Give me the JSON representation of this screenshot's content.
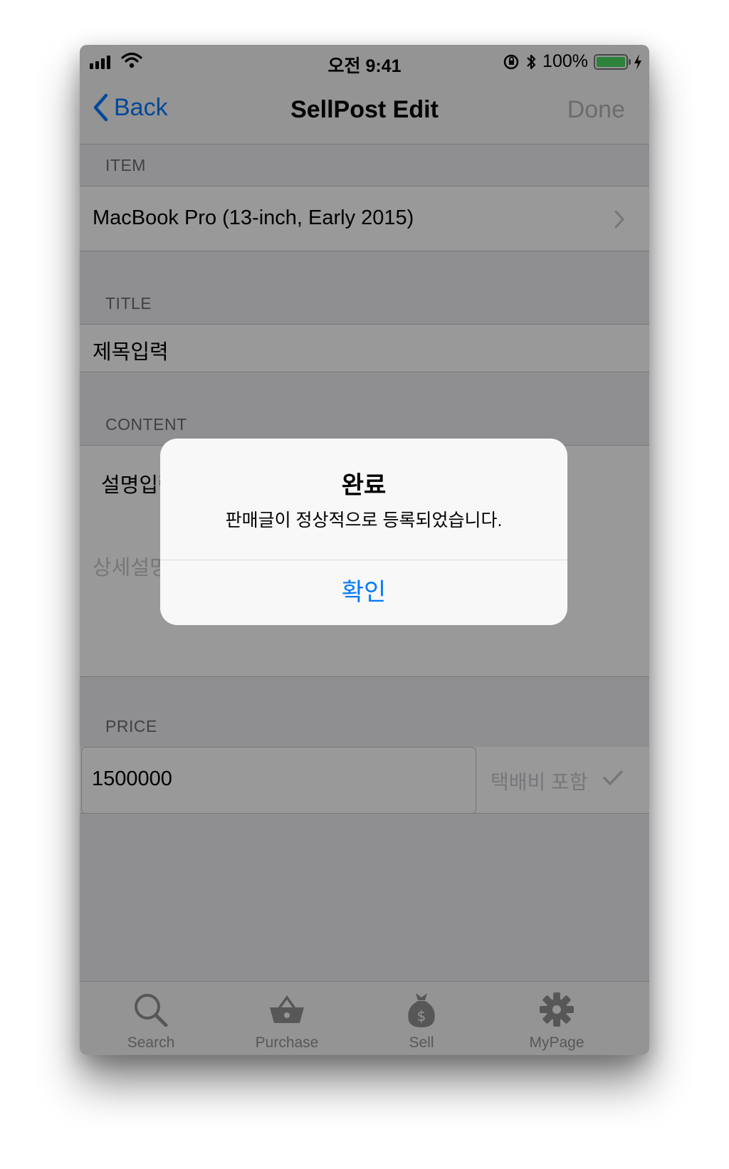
{
  "status_bar": {
    "time": "오전 9:41",
    "battery_percent": "100%",
    "battery_level": 1.0
  },
  "nav": {
    "back_label": "Back",
    "title": "SellPost Edit",
    "done_label": "Done"
  },
  "sections": {
    "item_header": "ITEM",
    "item_value": "MacBook Pro (13-inch, Early 2015)",
    "title_header": "TITLE",
    "title_value": "제목입력",
    "content_header": "CONTENT",
    "content_value": "설명입력",
    "content_placeholder": "상세설명",
    "price_header": "PRICE",
    "price_value": "1500000",
    "shipping_label": "택배비 포함"
  },
  "tab_bar": {
    "items": [
      {
        "label": "Search",
        "icon": "search-icon"
      },
      {
        "label": "Purchase",
        "icon": "basket-icon"
      },
      {
        "label": "Sell",
        "icon": "money-bag-icon"
      },
      {
        "label": "MyPage",
        "icon": "gear-icon"
      }
    ]
  },
  "alert": {
    "title": "완료",
    "message": "판매글이 정상적으로 등록되었습니다.",
    "confirm_label": "확인"
  },
  "colors": {
    "accent": "#007aff",
    "battery": "#4cd964"
  }
}
